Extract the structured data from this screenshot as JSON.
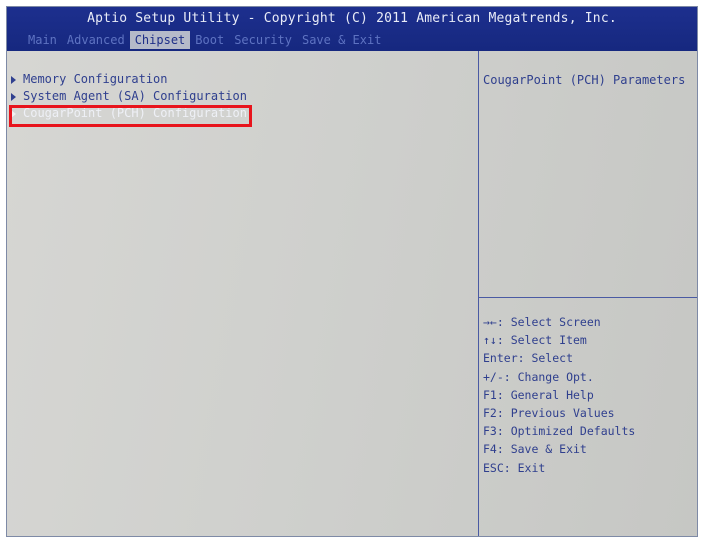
{
  "header": {
    "title": "Aptio Setup Utility - Copyright (C) 2011 American Megatrends, Inc.",
    "tabs": [
      {
        "label": "Main"
      },
      {
        "label": "Advanced"
      },
      {
        "label": "Chipset"
      },
      {
        "label": "Boot"
      },
      {
        "label": "Security"
      },
      {
        "label": "Save & Exit"
      }
    ],
    "active_tab": "Chipset"
  },
  "menu": {
    "items": [
      {
        "label": "Memory Configuration"
      },
      {
        "label": "System Agent (SA) Configuration"
      },
      {
        "label": "CougarPoint (PCH) Configuration"
      }
    ],
    "selected": "CougarPoint (PCH) Configuration"
  },
  "help": {
    "title": "CougarPoint (PCH) Parameters",
    "keys": [
      "→←: Select Screen",
      "↑↓: Select Item",
      "Enter: Select",
      "+/-: Change Opt.",
      "F1: General Help",
      "F2: Previous Values",
      "F3: Optimized Defaults",
      "F4: Save & Exit",
      "ESC: Exit"
    ]
  },
  "colors": {
    "header_bg": "#1d2f8e",
    "body_bg": "#c9cac8",
    "text": "#30408f",
    "highlight_box": "#e8141c"
  }
}
